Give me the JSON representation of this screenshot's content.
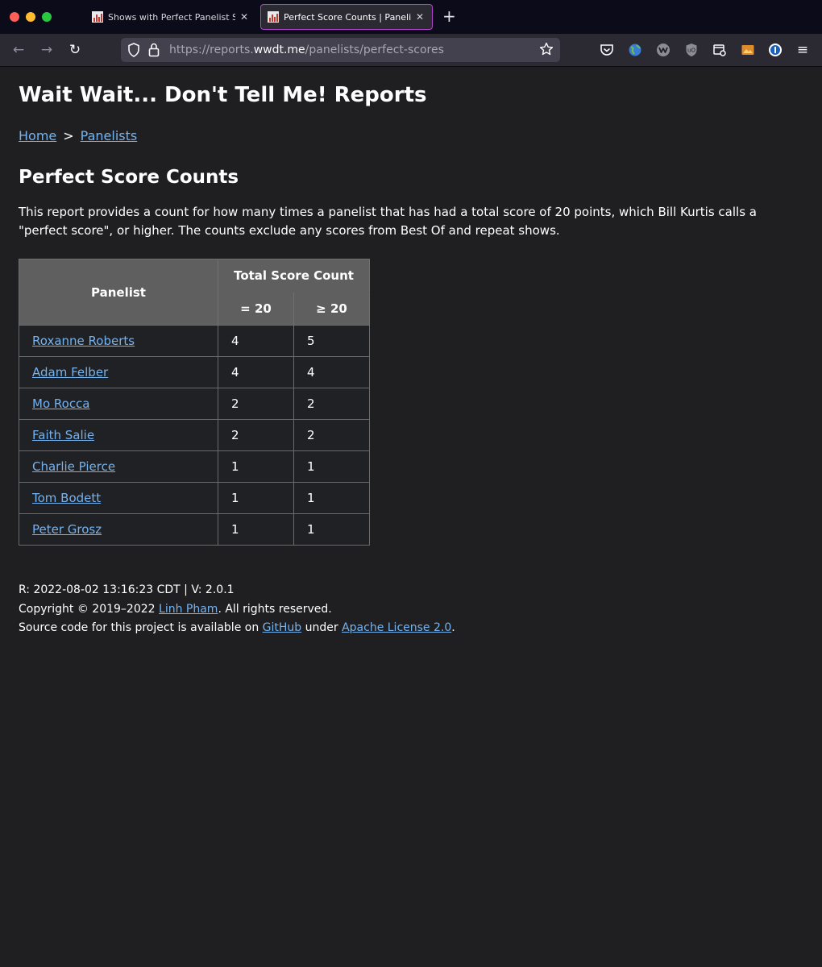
{
  "browser": {
    "tabs": [
      {
        "title": "Shows with Perfect Panelist Sco"
      },
      {
        "title": "Perfect Score Counts | Panelist"
      }
    ],
    "url": {
      "prefix": "https://reports.",
      "domain": "wwdt.me",
      "path": "/panelists/perfect-scores"
    }
  },
  "page": {
    "site_title": "Wait Wait... Don't Tell Me! Reports",
    "breadcrumb": {
      "home": "Home",
      "separator": ">",
      "panelists": "Panelists"
    },
    "title": "Perfect Score Counts",
    "description": "This report provides a count for how many times a panelist that has had a total score of 20 points, which Bill Kurtis calls a \"perfect score\", or higher. The counts exclude any scores from Best Of and repeat shows."
  },
  "table": {
    "headers": {
      "panelist": "Panelist",
      "total": "Total Score Count",
      "eq": "= 20",
      "ge": "≥ 20"
    },
    "rows": [
      {
        "name": "Roxanne Roberts",
        "eq": "4",
        "ge": "5"
      },
      {
        "name": "Adam Felber",
        "eq": "4",
        "ge": "4"
      },
      {
        "name": "Mo Rocca",
        "eq": "2",
        "ge": "2"
      },
      {
        "name": "Faith Salie",
        "eq": "2",
        "ge": "2"
      },
      {
        "name": "Charlie Pierce",
        "eq": "1",
        "ge": "1"
      },
      {
        "name": "Tom Bodett",
        "eq": "1",
        "ge": "1"
      },
      {
        "name": "Peter Grosz",
        "eq": "1",
        "ge": "1"
      }
    ]
  },
  "footer": {
    "build": "R: 2022-08-02 13:16:23 CDT | V: 2.0.1",
    "copyright_pre": "Copyright © 2019–2022 ",
    "author": "Linh Pham",
    "copyright_post": ". All rights reserved.",
    "source_pre": "Source code for this project is available on ",
    "github": "GitHub",
    "source_mid": " under ",
    "license": "Apache License 2.0",
    "source_post": "."
  },
  "colors": {
    "link": "#74b3f0",
    "background": "#202124",
    "table_header": "#5f5f5f",
    "active_tab_border": "#b046c9"
  }
}
